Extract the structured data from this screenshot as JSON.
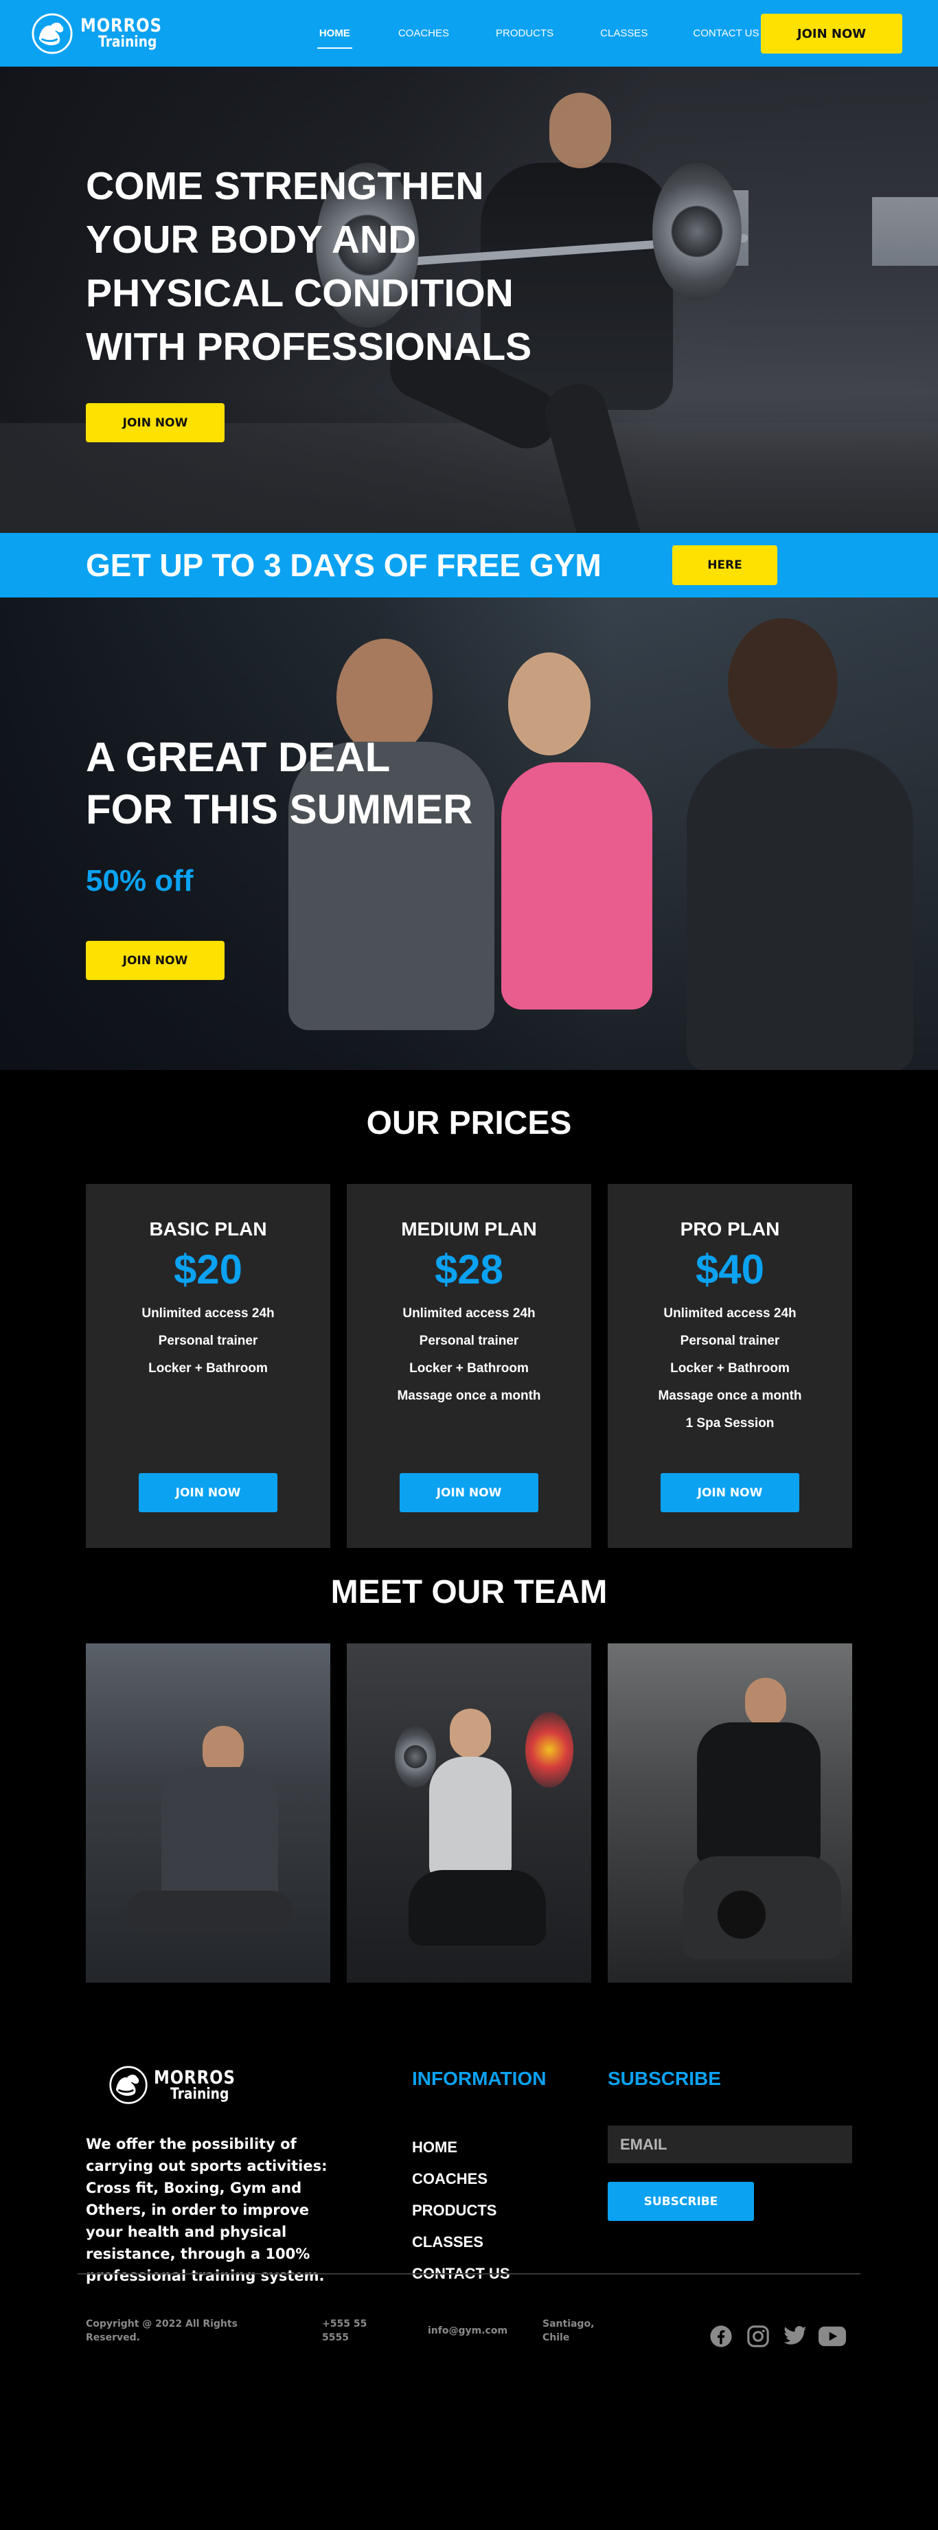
{
  "brand": {
    "title": "MORROS",
    "subtitle": "Training"
  },
  "nav": {
    "links": [
      "HOME",
      "COACHES",
      "PRODUCTS",
      "CLASSES",
      "CONTACT US"
    ],
    "active_index": 0,
    "cta": "JOIN NOW"
  },
  "hero": {
    "title": "COME STRENGTHEN YOUR BODY AND PHYSICAL CONDITION WITH PROFESSIONALS",
    "cta": "JOIN NOW"
  },
  "promo": {
    "text": "GET UP TO 3 DAYS OF FREE GYM",
    "cta": "HERE"
  },
  "deal": {
    "title_line1": "A GREAT DEAL",
    "title_line2": "FOR THIS SUMMER",
    "discount": "50% off",
    "cta": "JOIN NOW"
  },
  "prices": {
    "title": "OUR PRICES",
    "plans": [
      {
        "name": "BASIC PLAN",
        "price": "$20",
        "features": [
          "Unlimited access 24h",
          "Personal trainer",
          "Locker + Bathroom"
        ],
        "cta": "JOIN NOW"
      },
      {
        "name": "MEDIUM PLAN",
        "price": "$28",
        "features": [
          "Unlimited access 24h",
          "Personal trainer",
          "Locker + Bathroom",
          "Massage once a month"
        ],
        "cta": "JOIN NOW"
      },
      {
        "name": "PRO PLAN",
        "price": "$40",
        "features": [
          "Unlimited access 24h",
          "Personal trainer",
          "Locker + Bathroom",
          "Massage once a month",
          "1 Spa Session"
        ],
        "cta": "JOIN NOW"
      }
    ]
  },
  "team": {
    "title": "MEET OUR TEAM"
  },
  "footer": {
    "about": "We offer the possibility of carrying out sports activities: Cross fit, Boxing, Gym and Others, in order to improve your health and physical resistance, through a 100% professional training system.",
    "info_heading": "INFORMATION",
    "info_links": [
      "HOME",
      "COACHES",
      "PRODUCTS",
      "CLASSES",
      "CONTACT US"
    ],
    "subscribe_heading": "SUBSCRIBE",
    "email_placeholder": "EMAIL",
    "subscribe_cta": "SUBSCRIBE",
    "copyright": "Copyright @ 2022 All Rights Reserved.",
    "phone": "+555 55 5555",
    "email": "info@gym.com",
    "location": "Santiago, Chile",
    "socials": [
      "facebook-icon",
      "instagram-icon",
      "twitter-icon",
      "youtube-icon"
    ]
  },
  "colors": {
    "primary": "#0ba2f2",
    "accent": "#ffe100",
    "card": "#262626",
    "background": "#000000"
  }
}
